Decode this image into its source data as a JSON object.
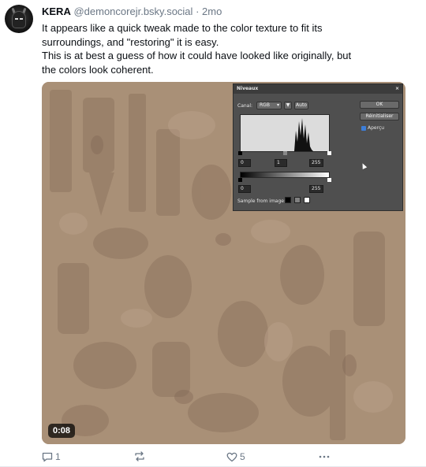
{
  "post": {
    "author": {
      "display_name": "KERA",
      "handle": "@demoncorejr.bsky.social",
      "separator": "·",
      "time": "2mo"
    },
    "text_lines": [
      "It appears like a quick tweak made to the color texture to fit its",
      "surroundings, and \"restoring\" it is easy.",
      "This is at best a guess of how it could have looked like originally, but",
      "the colors look coherent."
    ],
    "video": {
      "duration": "0:08",
      "levels_dialog": {
        "title": "Niveaux",
        "close": "×",
        "canal_label": "Canal:",
        "canal_value": "RGB",
        "auto_button": "Auto",
        "ok_button": "OK",
        "reset_button": "Réinitialiser",
        "preview_label": "Aperçu",
        "input_black": "0",
        "input_gamma": "1",
        "input_white": "255",
        "output_black": "0",
        "output_white": "255",
        "sample_label": "Sample from image:"
      }
    },
    "stats": {
      "replies": "1",
      "likes": "5"
    }
  },
  "colors": {
    "texture_base": "#a99077",
    "dialog_bg": "#4f4f4f",
    "muted_text": "#6b7785"
  }
}
